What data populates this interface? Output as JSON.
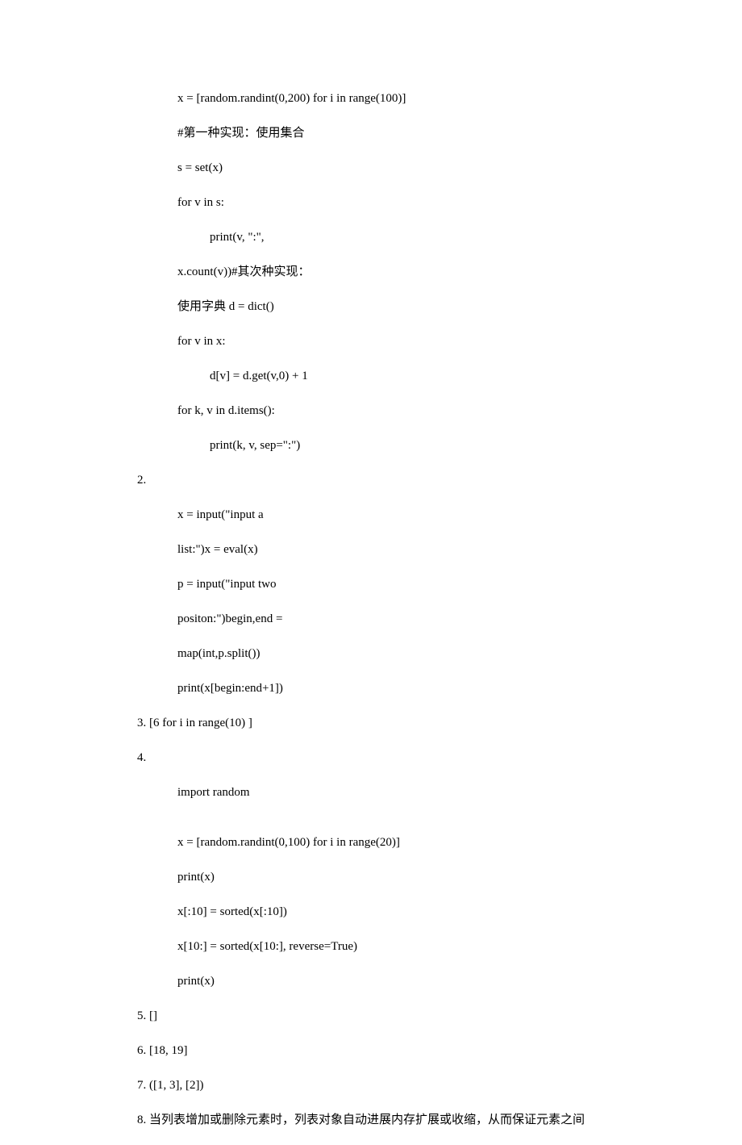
{
  "lines": [
    {
      "cls": "indent-1 line",
      "text": "x = [random.randint(0,200) for i in range(100)]"
    },
    {
      "cls": "indent-1 line",
      "text": "#第一种实现：使用集合"
    },
    {
      "cls": "indent-1 line",
      "text": "s = set(x)"
    },
    {
      "cls": "indent-1 line",
      "text": "for v in s:"
    },
    {
      "cls": "indent-2 line",
      "text": "print(v, \":\","
    },
    {
      "cls": "indent-1 line",
      "text": "x.count(v))#其次种实现："
    },
    {
      "cls": "indent-1 line",
      "text": "使用字典  d = dict()"
    },
    {
      "cls": "indent-1 line",
      "text": "for v in x:"
    },
    {
      "cls": "indent-2 line",
      "text": "d[v] = d.get(v,0) + 1"
    },
    {
      "cls": "indent-1 line",
      "text": "for k, v in d.items():"
    },
    {
      "cls": "indent-2 line",
      "text": "print(k, v, sep=\":\")"
    },
    {
      "cls": "num-line",
      "text": "2."
    },
    {
      "cls": "indent-1 line",
      "text": "x = input(\"input a"
    },
    {
      "cls": "indent-1 line",
      "text": "list:\")x = eval(x)"
    },
    {
      "cls": "indent-1 line",
      "text": "p = input(\"input two"
    },
    {
      "cls": "indent-1 line",
      "text": "positon:\")begin,end ="
    },
    {
      "cls": "indent-1 line",
      "text": "map(int,p.split())"
    },
    {
      "cls": "indent-1 line",
      "text": "print(x[begin:end+1])"
    },
    {
      "cls": "num-line",
      "text": "3. [6 for i in range(10) ]"
    },
    {
      "cls": "num-line",
      "text": "4."
    },
    {
      "cls": "indent-1 gap",
      "text": "import random"
    },
    {
      "cls": "indent-1 line",
      "text": "x = [random.randint(0,100) for i in range(20)]"
    },
    {
      "cls": "indent-1 line",
      "text": "print(x)"
    },
    {
      "cls": "indent-1 line",
      "text": "x[:10] = sorted(x[:10])"
    },
    {
      "cls": "indent-1 line",
      "text": "x[10:] = sorted(x[10:], reverse=True)"
    },
    {
      "cls": "indent-1 line",
      "text": "print(x)"
    },
    {
      "cls": "num-line",
      "text": "5. []"
    },
    {
      "cls": "num-line",
      "text": "6. [18, 19]"
    },
    {
      "cls": "num-line",
      "text": "7. ([1, 3], [2])"
    },
    {
      "cls": "num-line",
      "text": "8. 当列表增加或删除元素时，列表对象自动进展内存扩展或收缩，从而保证元素之间"
    }
  ]
}
